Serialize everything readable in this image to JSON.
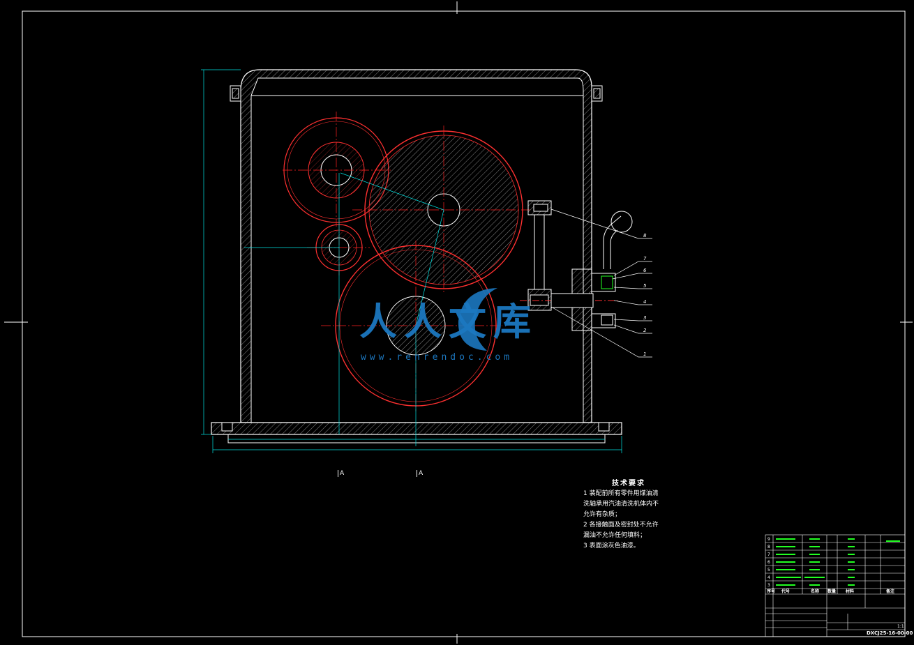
{
  "tech_requirements": {
    "heading": "技术要求",
    "lines": [
      "1 装配前所有零件用煤油清",
      "洗轴承用汽油清洗机体内不",
      "允许有杂质；",
      "2 各接触面及密封处不允许",
      "漏油不允许任何填料；",
      "3 表面涂灰色油漆。"
    ]
  },
  "section_marks": [
    "A",
    "A"
  ],
  "watermark": {
    "brand": "人人文库",
    "url": "www.renrendoc.com"
  },
  "title_block": {
    "drawing_number": "DXCJ25-16-00-00",
    "scale": "1:1",
    "parts_list_header": [
      "序号",
      "代号",
      "名称",
      "数量",
      "材料",
      "备注"
    ],
    "part_numbers": [
      "9",
      "8",
      "7",
      "6",
      "5",
      "4",
      "3",
      "2",
      "1"
    ]
  },
  "callouts": [
    "8",
    "7",
    "6",
    "5",
    "4",
    "3",
    "2",
    "1"
  ],
  "colors": {
    "outline": "#ffffff",
    "dimension": "#00e5e5",
    "center": "#ff2020",
    "gear": "#ff3030",
    "label": "#22ff22",
    "watermark": "#1c78c0"
  }
}
